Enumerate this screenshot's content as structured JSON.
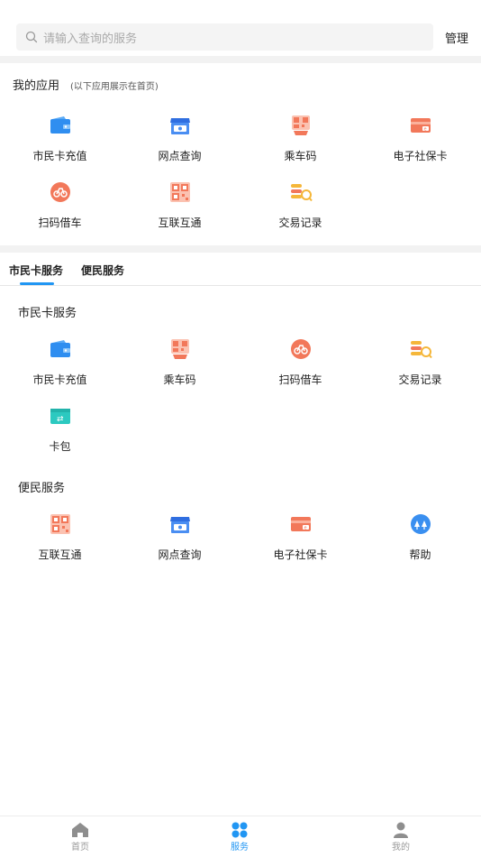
{
  "search": {
    "placeholder": "请输入查询的服务",
    "manage_label": "管理"
  },
  "my_apps": {
    "title": "我的应用",
    "subtitle": "(以下应用展示在首页)",
    "items": [
      {
        "label": "市民卡充值",
        "icon": "wallet-icon"
      },
      {
        "label": "网点查询",
        "icon": "store-icon"
      },
      {
        "label": "乘车码",
        "icon": "qr-ride-icon"
      },
      {
        "label": "电子社保卡",
        "icon": "social-card-icon"
      },
      {
        "label": "扫码借车",
        "icon": "bike-icon"
      },
      {
        "label": "互联互通",
        "icon": "qr-code-icon"
      },
      {
        "label": "交易记录",
        "icon": "coins-search-icon"
      }
    ]
  },
  "tabs": [
    {
      "label": "市民卡服务"
    },
    {
      "label": "便民服务"
    }
  ],
  "citizen_card": {
    "title": "市民卡服务",
    "items": [
      {
        "label": "市民卡充值",
        "icon": "wallet-icon"
      },
      {
        "label": "乘车码",
        "icon": "qr-ride-icon"
      },
      {
        "label": "扫码借车",
        "icon": "bike-icon"
      },
      {
        "label": "交易记录",
        "icon": "coins-search-icon"
      },
      {
        "label": "卡包",
        "icon": "card-wallet-icon"
      }
    ]
  },
  "convenience": {
    "title": "便民服务",
    "items": [
      {
        "label": "互联互通",
        "icon": "qr-code-icon"
      },
      {
        "label": "网点查询",
        "icon": "store-icon"
      },
      {
        "label": "电子社保卡",
        "icon": "social-card-icon"
      },
      {
        "label": "帮助",
        "icon": "help-icon"
      }
    ]
  },
  "bottom_nav": [
    {
      "label": "首页",
      "icon": "home-icon",
      "active": false
    },
    {
      "label": "服务",
      "icon": "services-icon",
      "active": true
    },
    {
      "label": "我的",
      "icon": "profile-icon",
      "active": false
    }
  ],
  "colors": {
    "accent": "#2196f3",
    "orange": "#f2785a",
    "blue_icon": "#2f8ef0"
  }
}
